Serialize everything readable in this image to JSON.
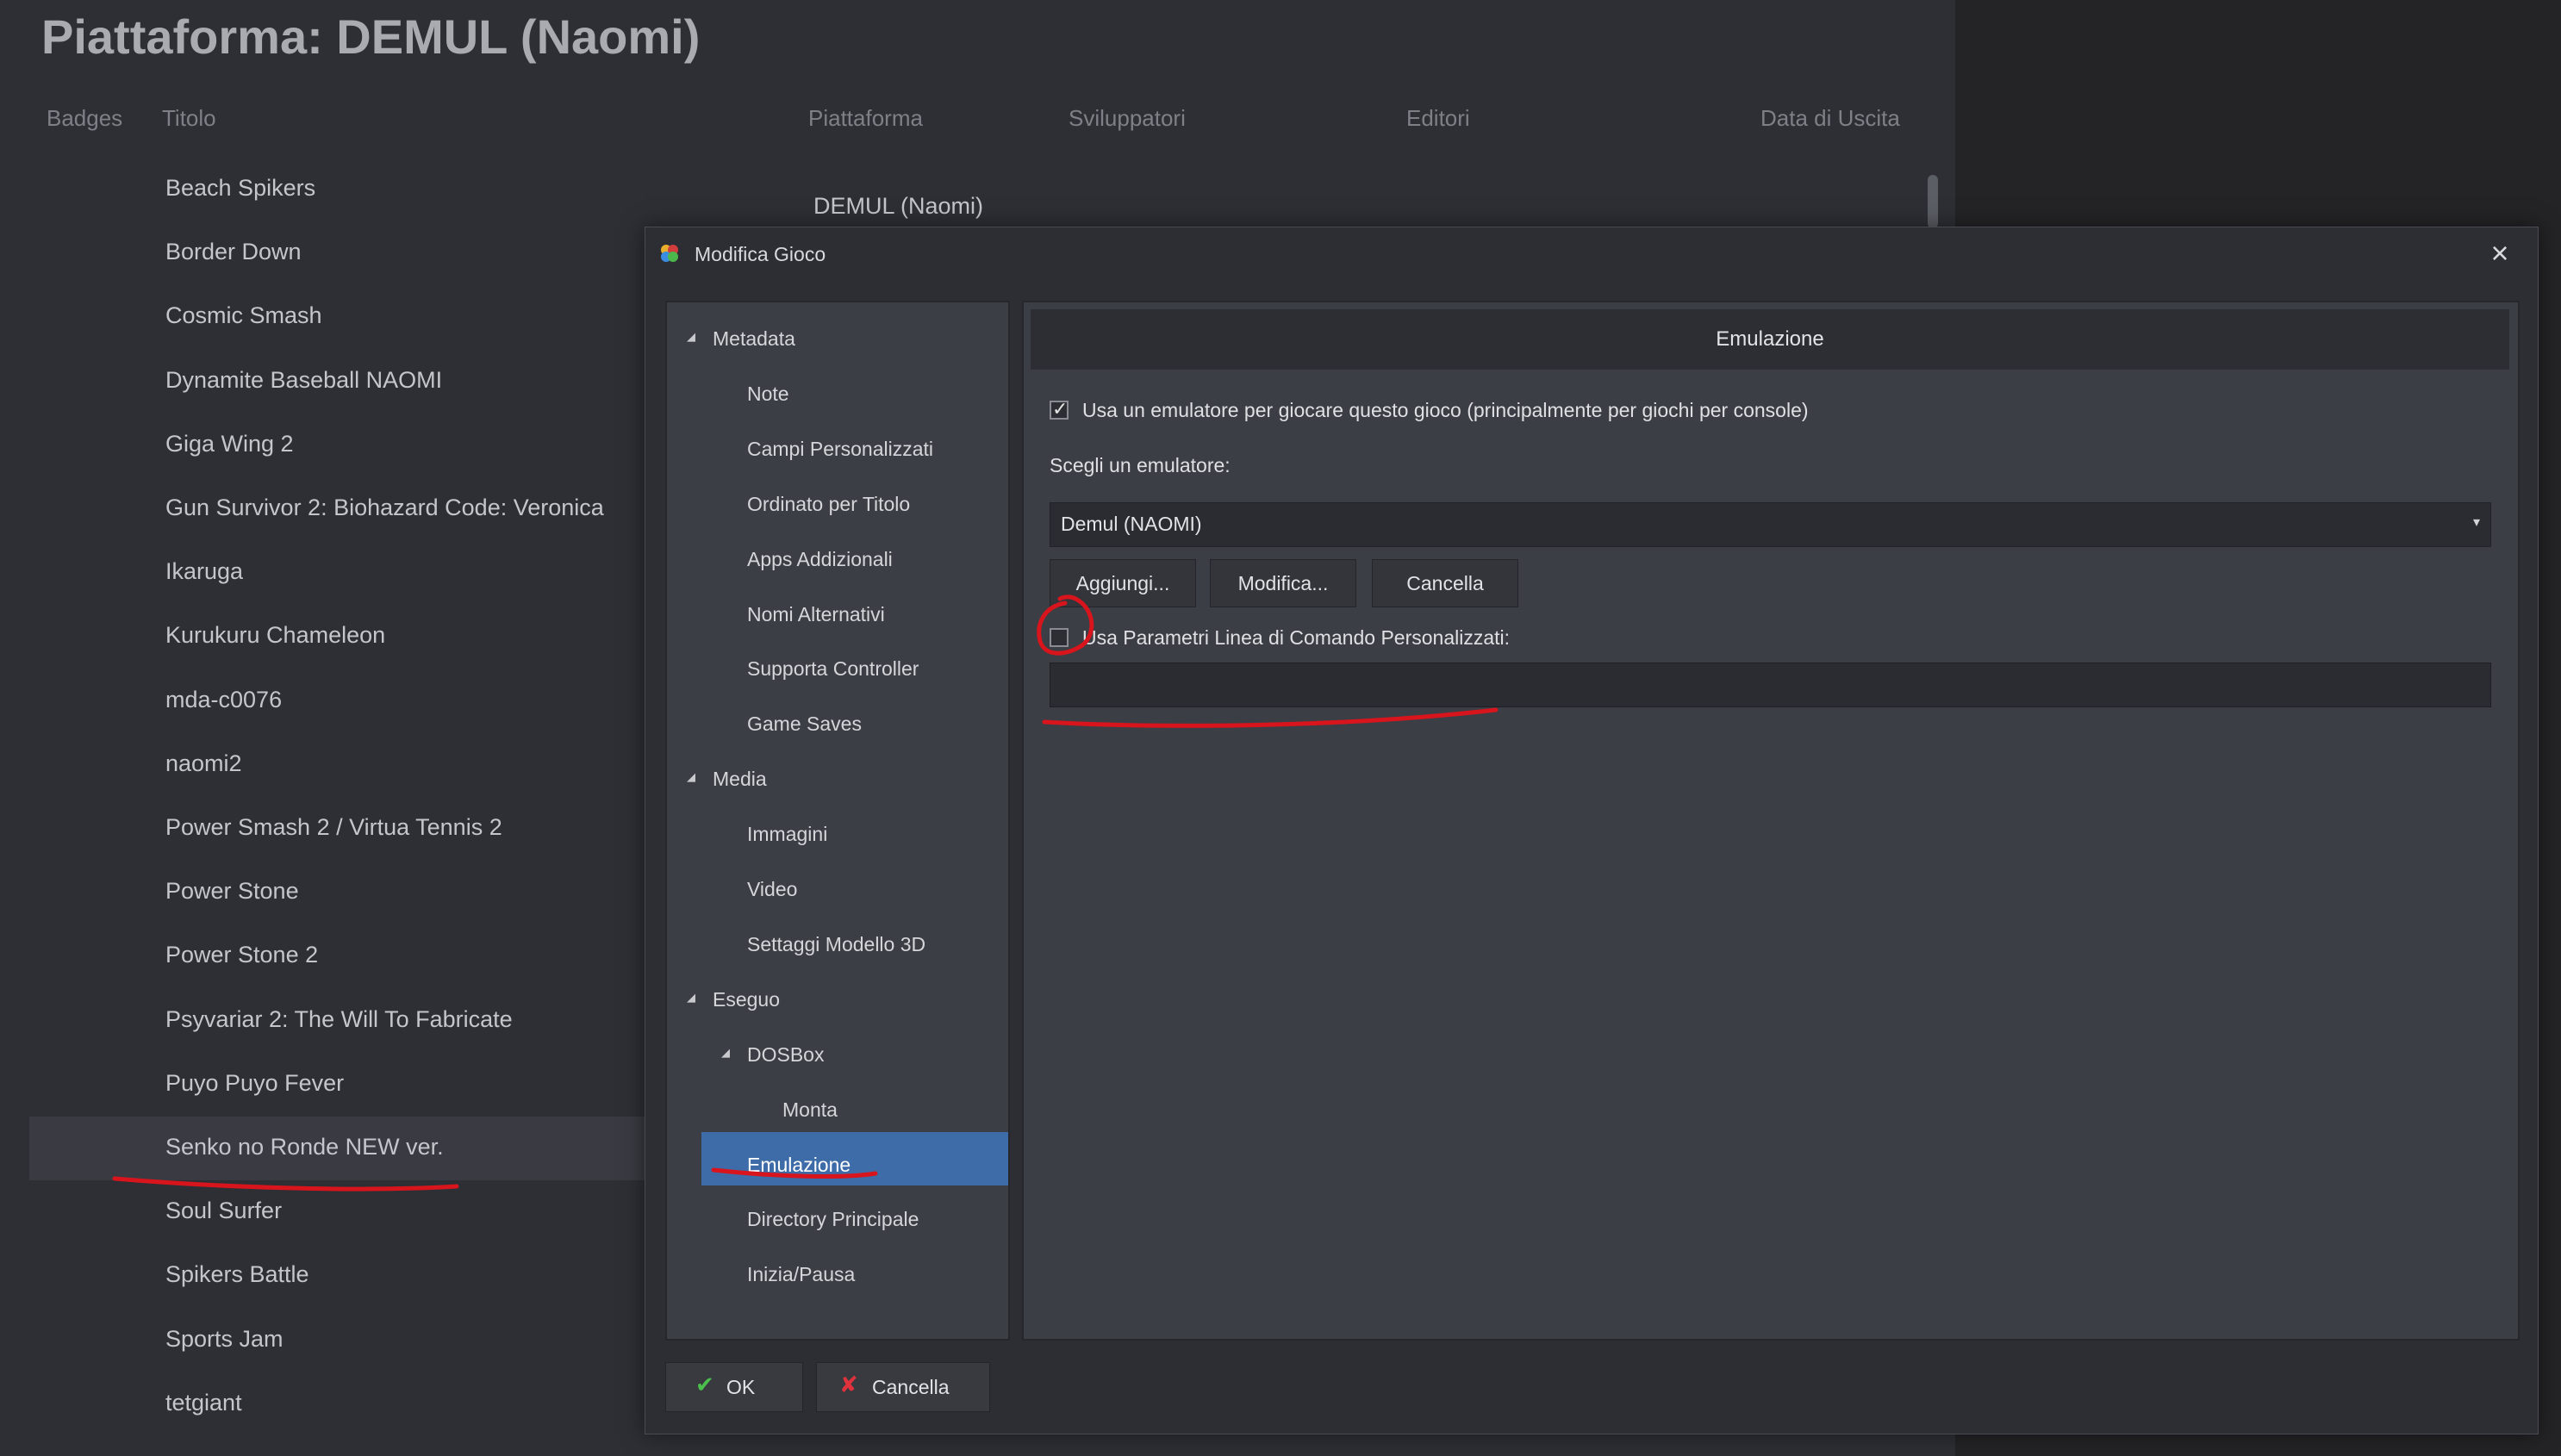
{
  "background": {
    "page_title": "Piattaforma: DEMUL (Naomi)",
    "columns": [
      "Badges",
      "Titolo",
      "Piattaforma",
      "Sviluppatori",
      "Editori",
      "Data di Uscita"
    ],
    "first_row_platform": "DEMUL (Naomi)",
    "games": [
      "Beach Spikers",
      "Border Down",
      "Cosmic Smash",
      "Dynamite Baseball NAOMI",
      "Giga Wing 2",
      "Gun Survivor 2: Biohazard Code: Veronica",
      "Ikaruga",
      "Kurukuru Chameleon",
      "mda-c0076",
      "naomi2",
      "Power Smash 2 / Virtua Tennis 2",
      "Power Stone",
      "Power Stone 2",
      "Psyvariar 2: The Will To Fabricate",
      "Puyo Puyo Fever",
      "Senko no Ronde NEW ver.",
      "Soul Surfer",
      "Spikers Battle",
      "Sports Jam",
      "tetgiant"
    ],
    "selected_game": "Senko no Ronde NEW ver."
  },
  "dialog": {
    "title": "Modifica Gioco",
    "logo_icon": "launchbox-logo-icon",
    "close_icon": "close-icon",
    "tree": [
      {
        "label": "Metadata",
        "level": 0,
        "expanded": true
      },
      {
        "label": "Note",
        "level": 1
      },
      {
        "label": "Campi Personalizzati",
        "level": 1
      },
      {
        "label": "Ordinato per Titolo",
        "level": 1
      },
      {
        "label": "Apps Addizionali",
        "level": 1
      },
      {
        "label": "Nomi Alternativi",
        "level": 1
      },
      {
        "label": "Supporta Controller",
        "level": 1
      },
      {
        "label": "Game Saves",
        "level": 1
      },
      {
        "label": "Media",
        "level": 0,
        "expanded": true
      },
      {
        "label": "Immagini",
        "level": 1
      },
      {
        "label": "Video",
        "level": 1
      },
      {
        "label": "Settaggi Modello 3D",
        "level": 1
      },
      {
        "label": "Eseguo",
        "level": 0,
        "expanded": true
      },
      {
        "label": "DOSBox",
        "level": 1,
        "expanded": true
      },
      {
        "label": "Monta",
        "level": 2
      },
      {
        "label": "Emulazione",
        "level": 1,
        "selected": true
      },
      {
        "label": "Directory Principale",
        "level": 1
      },
      {
        "label": "Inizia/Pausa",
        "level": 1
      }
    ],
    "section_header": "Emulazione",
    "use_emulator": {
      "label": "Usa un emulatore per giocare questo gioco (principalmente per giochi per console)",
      "checked": true
    },
    "choose_emulator_label": "Scegli un emulatore:",
    "emulator_selected": "Demul (NAOMI)",
    "buttons": {
      "add": "Aggiungi...",
      "edit": "Modifica...",
      "delete": "Cancella"
    },
    "custom_params": {
      "label": "Usa Parametri Linea di Comando Personalizzati:",
      "checked": false,
      "value": ""
    },
    "footer": {
      "ok": "OK",
      "cancel": "Cancella"
    }
  },
  "colors": {
    "accent_selected": "#3e6ca8",
    "annotation_red": "#d8141c",
    "ok_green": "#4cc04c",
    "cancel_red": "#e0323c"
  }
}
